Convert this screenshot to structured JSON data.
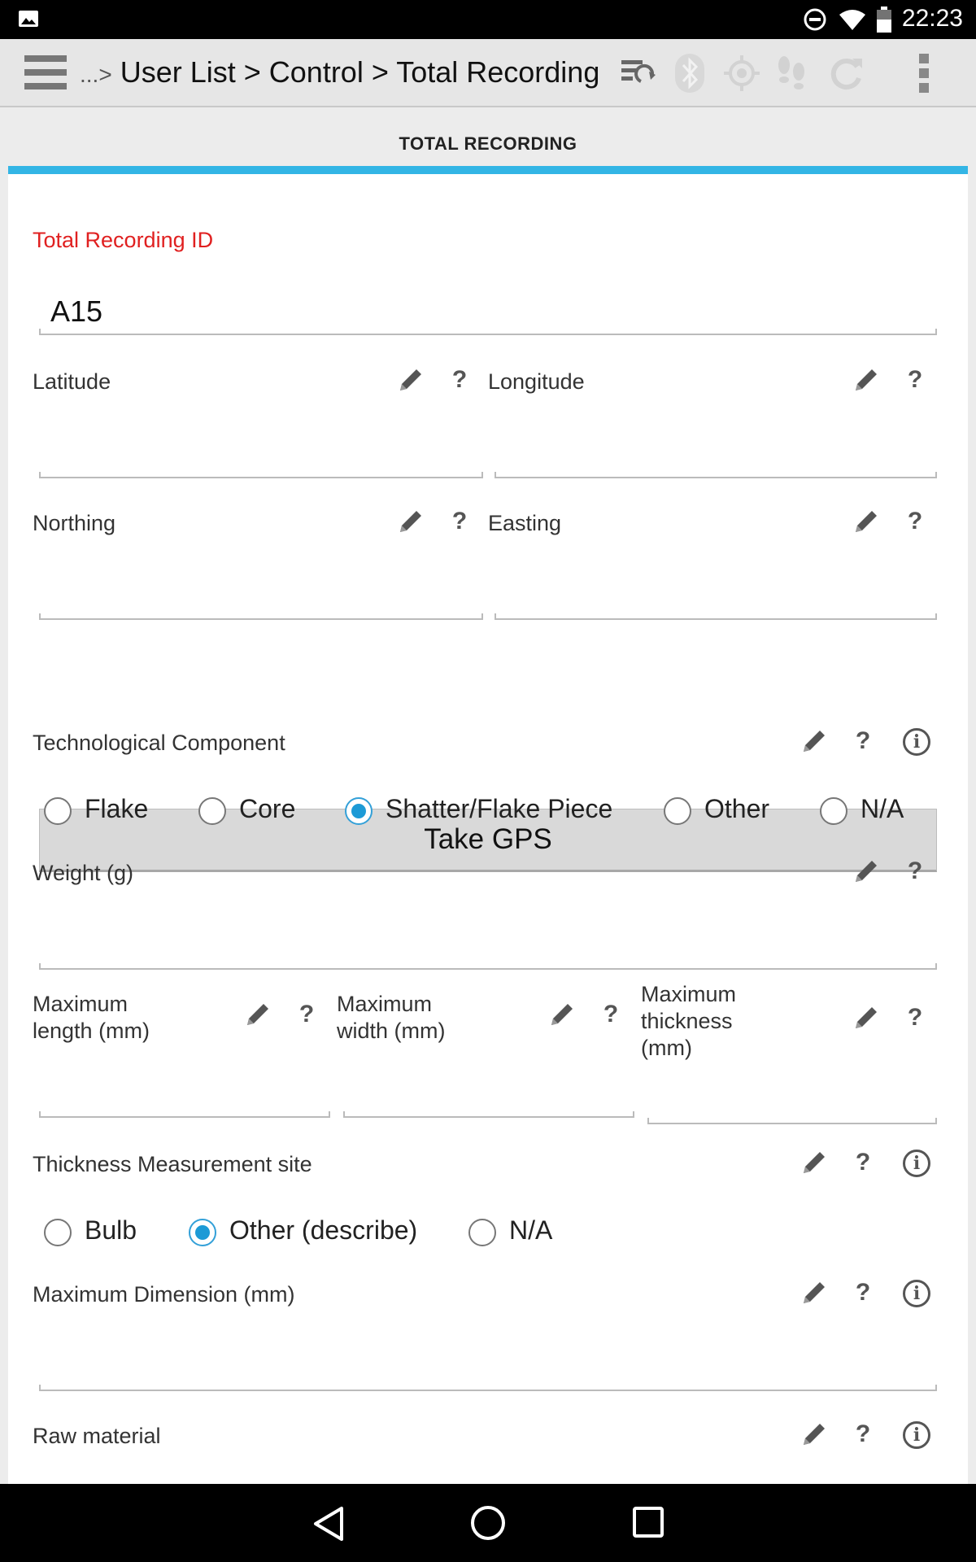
{
  "status": {
    "time": "22:23"
  },
  "toolbar": {
    "breadcrumb_prefix": "...>",
    "breadcrumb": "User List > Control > Total Recording"
  },
  "tab": {
    "label": "TOTAL RECORDING"
  },
  "form": {
    "recording_id": {
      "label": "Total Recording ID",
      "value": "A15"
    },
    "latitude": {
      "label": "Latitude",
      "value": ""
    },
    "longitude": {
      "label": "Longitude",
      "value": ""
    },
    "northing": {
      "label": "Northing",
      "value": ""
    },
    "easting": {
      "label": "Easting",
      "value": ""
    },
    "gps_button": "Take GPS",
    "tech_component": {
      "label": "Technological Component",
      "options": [
        "Flake",
        "Core",
        "Shatter/Flake Piece",
        "Other",
        "N/A"
      ],
      "selected": "Shatter/Flake Piece"
    },
    "weight": {
      "label": "Weight (g)",
      "value": ""
    },
    "max_length": {
      "label_line1": "Maximum",
      "label_line2": "length (mm)"
    },
    "max_width": {
      "label_line1": "Maximum",
      "label_line2": "width (mm)"
    },
    "max_thickness": {
      "label_line1": "Maximum",
      "label_line2": "thickness",
      "label_line3": "(mm)"
    },
    "thickness_site": {
      "label": "Thickness Measurement site",
      "options": [
        "Bulb",
        "Other (describe)",
        "N/A"
      ],
      "selected": "Other (describe)"
    },
    "max_dimension": {
      "label": "Maximum Dimension (mm)",
      "value": ""
    },
    "raw_material": {
      "label": "Raw material"
    },
    "help_glyph": "?",
    "info_glyph": "i"
  },
  "colors": {
    "accent": "#33b5e5",
    "required": "#e02020",
    "radio_selected": "#1c9ad6"
  }
}
